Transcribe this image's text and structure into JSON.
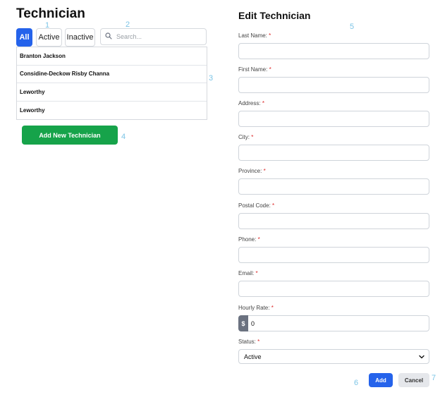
{
  "left_panel": {
    "title": "Technician",
    "filters": {
      "all": "All",
      "active": "Active",
      "inactive": "Inactive"
    },
    "search": {
      "placeholder": "Search..."
    },
    "technicians": [
      "Branton Jackson",
      "Considine-Deckow Risby Channa",
      "Leworthy",
      "Leworthy"
    ],
    "add_button": "Add New Technician"
  },
  "edit_panel": {
    "title": "Edit Technician",
    "required_marker": "*",
    "labels": {
      "last_name": "Last Name:",
      "first_name": "First Name:",
      "address": "Address:",
      "city": "City:",
      "province": "Province:",
      "postal_code": "Postal Code:",
      "phone": "Phone:",
      "email": "Email:",
      "hourly_rate": "Hourly Rate:",
      "status": "Status:"
    },
    "values": {
      "last_name": "",
      "first_name": "",
      "address": "",
      "city": "",
      "province": "",
      "postal_code": "",
      "phone": "",
      "email": "",
      "hourly_rate": "0",
      "status": "Active"
    },
    "currency_symbol": "$",
    "add_button": "Add",
    "cancel_button": "Cancel"
  },
  "annotations": [
    "1",
    "2",
    "3",
    "4",
    "5",
    "6",
    "7"
  ],
  "colors": {
    "primary": "#2563eb",
    "success": "#16a34a",
    "required": "#dc2626",
    "annotation": "#7cc4e6"
  }
}
